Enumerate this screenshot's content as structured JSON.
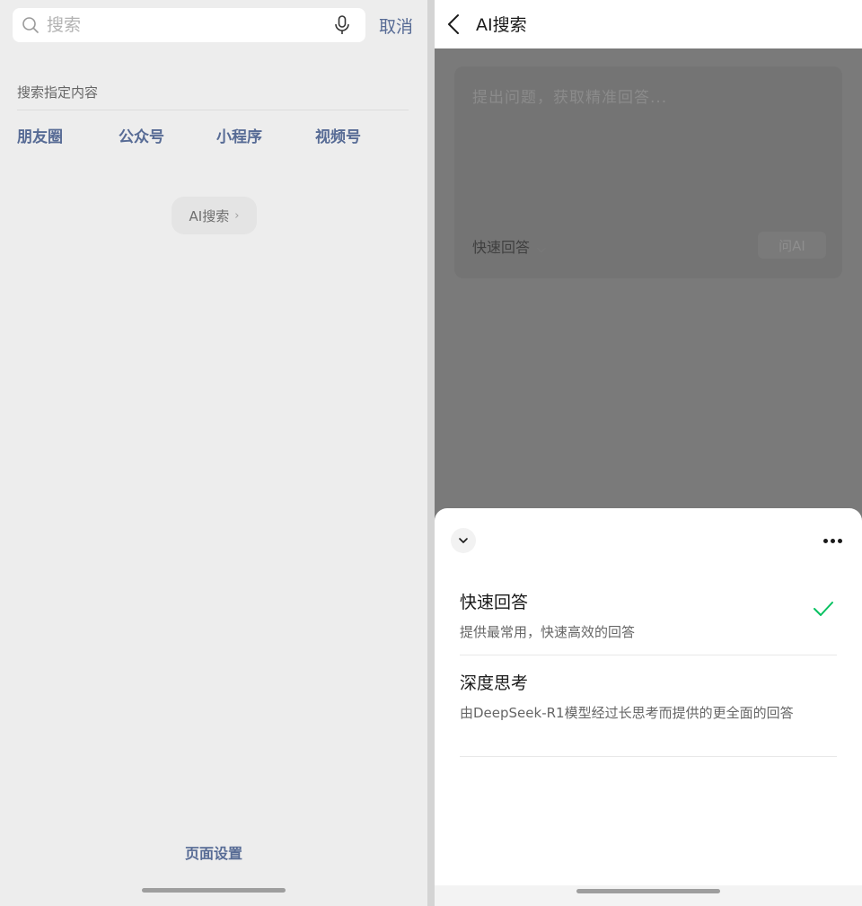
{
  "left": {
    "search": {
      "placeholder": "搜索",
      "cancel_label": "取消"
    },
    "section_title": "搜索指定内容",
    "categories": [
      "朋友圈",
      "公众号",
      "小程序",
      "视频号"
    ],
    "ai_chip": {
      "label": "AI搜索",
      "chevron": "›"
    },
    "page_settings_label": "页面设置"
  },
  "right": {
    "header": {
      "title": "AI搜索"
    },
    "input_card": {
      "placeholder": "提出问题，获取精准回答...",
      "mode_label": "快速回答",
      "ask_button": "问AI"
    },
    "sheet": {
      "options": [
        {
          "title": "快速回答",
          "desc": "提供最常用，快速高效的回答",
          "selected": true
        },
        {
          "title": "深度思考",
          "desc": "由DeepSeek-R1模型经过长思考而提供的更全面的回答",
          "selected": false
        }
      ]
    }
  },
  "colors": {
    "link_blue": "#576b95",
    "check_green": "#07c160",
    "left_bg": "#ededed",
    "dim_overlay": "#7a7a7a"
  },
  "icons": [
    "search-icon",
    "microphone-icon",
    "chevron-right-icon",
    "back-arrow-icon",
    "chevron-down-icon",
    "more-icon",
    "checkmark-icon"
  ]
}
